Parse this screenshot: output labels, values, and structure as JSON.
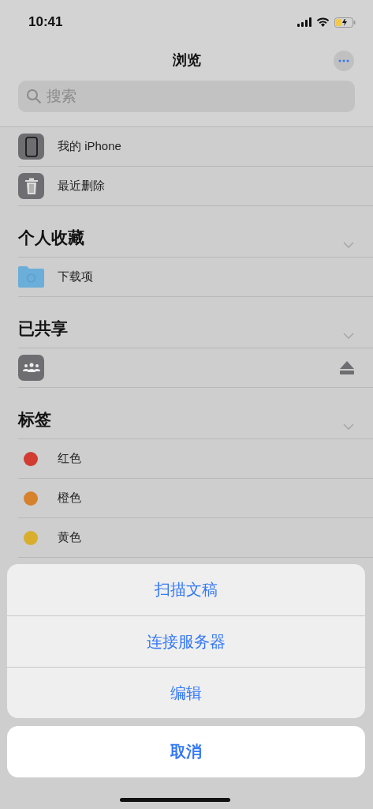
{
  "status_bar": {
    "time": "10:41"
  },
  "nav": {
    "title": "浏览"
  },
  "search": {
    "placeholder": "搜索"
  },
  "locations": [
    {
      "kind": "phone",
      "label": "我的 iPhone"
    },
    {
      "kind": "trash",
      "label": "最近删除"
    }
  ],
  "sections": [
    {
      "title": "个人收藏",
      "expanded": true,
      "items": [
        {
          "kind": "folder",
          "label": "下载项"
        }
      ]
    },
    {
      "title": "已共享",
      "expanded": true,
      "items": [
        {
          "kind": "shared",
          "eject": true
        }
      ]
    },
    {
      "title": "标签",
      "expanded": true,
      "items": [
        {
          "kind": "tag",
          "label": "红色",
          "color": "#d13b30"
        },
        {
          "kind": "tag",
          "label": "橙色",
          "color": "#d6822c"
        },
        {
          "kind": "tag",
          "label": "黄色",
          "color": "#d8ae2c"
        }
      ]
    }
  ],
  "action_sheet": {
    "actions": [
      "扫描文稿",
      "连接服务器",
      "编辑"
    ],
    "cancel": "取消"
  }
}
